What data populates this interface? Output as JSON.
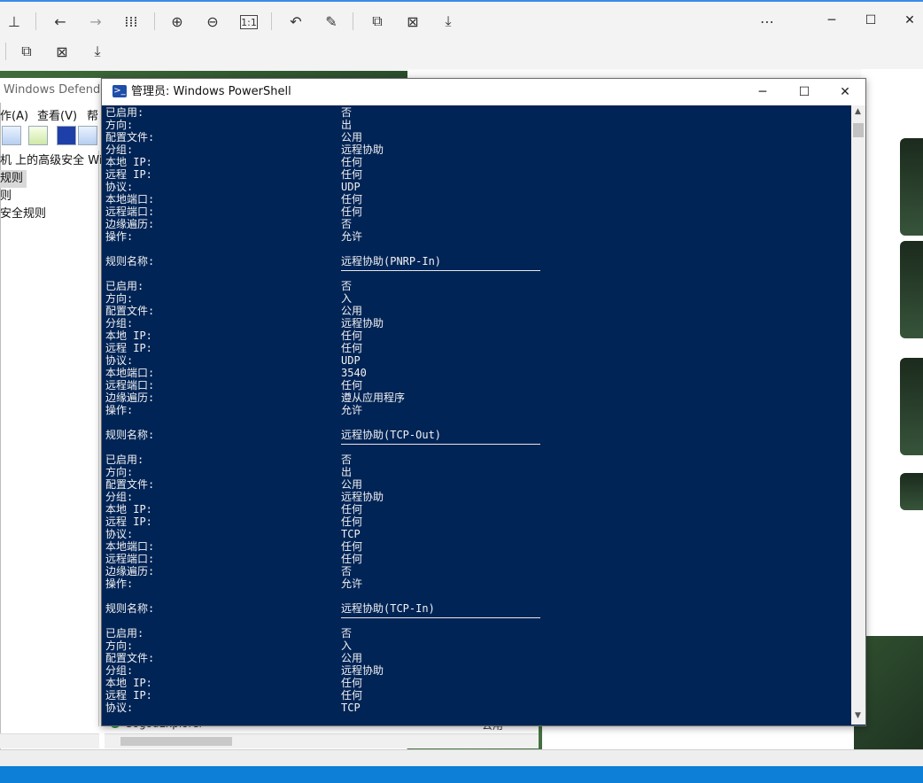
{
  "viewer": {
    "toolbar_icons": [
      "pin-icon",
      "back-icon",
      "forward-icon",
      "grid-icon",
      "zoom-in-icon",
      "zoom-out-icon",
      "actual-size-icon",
      "rotate-icon",
      "edit-icon",
      "translate-icon",
      "ocr-icon",
      "save-icon"
    ],
    "toolbar2_icons": [
      "translate-icon",
      "ocr-icon",
      "save-icon"
    ],
    "more": "⋯",
    "minimize": "─",
    "maximize": "☐",
    "close": "✕"
  },
  "defender": {
    "title": "Windows Defender",
    "menu": [
      "作(A)",
      "查看(V)",
      "帮"
    ],
    "tree": [
      "机 上的高级安全 Wind",
      "规则",
      "则",
      "安全规则"
    ],
    "status_row_name": "SogouExplorer",
    "status_row_profile": "公用"
  },
  "powershell": {
    "title": "管理员: Windows PowerShell",
    "minimize": "─",
    "maximize": "☐",
    "close": "✕",
    "lines": [
      {
        "label": "已启用:",
        "value": "否"
      },
      {
        "label": "方向:",
        "value": "出"
      },
      {
        "label": "配置文件:",
        "value": "公用"
      },
      {
        "label": "分组:",
        "value": "远程协助"
      },
      {
        "label": "本地 IP:",
        "value": "任何"
      },
      {
        "label": "远程 IP:",
        "value": "任何"
      },
      {
        "label": "协议:",
        "value": "UDP"
      },
      {
        "label": "本地端口:",
        "value": "任何"
      },
      {
        "label": "远程端口:",
        "value": "任何"
      },
      {
        "label": "边缘遍历:",
        "value": "否"
      },
      {
        "label": "操作:",
        "value": "允许"
      },
      {
        "label": "",
        "value": ""
      },
      {
        "label": "规则名称:",
        "value": "远程协助(PNRP-In)"
      },
      {
        "rule": true
      },
      {
        "label": "已启用:",
        "value": "否"
      },
      {
        "label": "方向:",
        "value": "入"
      },
      {
        "label": "配置文件:",
        "value": "公用"
      },
      {
        "label": "分组:",
        "value": "远程协助"
      },
      {
        "label": "本地 IP:",
        "value": "任何"
      },
      {
        "label": "远程 IP:",
        "value": "任何"
      },
      {
        "label": "协议:",
        "value": "UDP"
      },
      {
        "label": "本地端口:",
        "value": "3540"
      },
      {
        "label": "远程端口:",
        "value": "任何"
      },
      {
        "label": "边缘遍历:",
        "value": "遵从应用程序"
      },
      {
        "label": "操作:",
        "value": "允许"
      },
      {
        "label": "",
        "value": ""
      },
      {
        "label": "规则名称:",
        "value": "远程协助(TCP-Out)"
      },
      {
        "rule": true
      },
      {
        "label": "已启用:",
        "value": "否"
      },
      {
        "label": "方向:",
        "value": "出"
      },
      {
        "label": "配置文件:",
        "value": "公用"
      },
      {
        "label": "分组:",
        "value": "远程协助"
      },
      {
        "label": "本地 IP:",
        "value": "任何"
      },
      {
        "label": "远程 IP:",
        "value": "任何"
      },
      {
        "label": "协议:",
        "value": "TCP"
      },
      {
        "label": "本地端口:",
        "value": "任何"
      },
      {
        "label": "远程端口:",
        "value": "任何"
      },
      {
        "label": "边缘遍历:",
        "value": "否"
      },
      {
        "label": "操作:",
        "value": "允许"
      },
      {
        "label": "",
        "value": ""
      },
      {
        "label": "规则名称:",
        "value": "远程协助(TCP-In)"
      },
      {
        "rule": true
      },
      {
        "label": "已启用:",
        "value": "否"
      },
      {
        "label": "方向:",
        "value": "入"
      },
      {
        "label": "配置文件:",
        "value": "公用"
      },
      {
        "label": "分组:",
        "value": "远程协助"
      },
      {
        "label": "本地 IP:",
        "value": "任何"
      },
      {
        "label": "远程 IP:",
        "value": "任何"
      },
      {
        "label": "协议:",
        "value": "TCP"
      }
    ]
  }
}
